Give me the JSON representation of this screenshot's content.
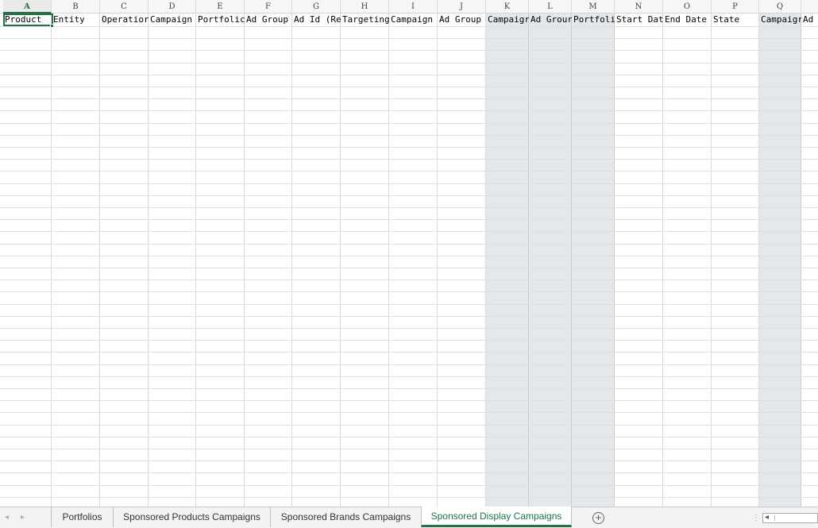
{
  "grid": {
    "columns": [
      {
        "letter": "A",
        "header": "Product",
        "shaded": false,
        "active": true
      },
      {
        "letter": "B",
        "header": "Entity",
        "shaded": false
      },
      {
        "letter": "C",
        "header": "Operatior",
        "shaded": false
      },
      {
        "letter": "D",
        "header": "Campaign",
        "shaded": false
      },
      {
        "letter": "E",
        "header": "Portfolic",
        "shaded": false
      },
      {
        "letter": "F",
        "header": "Ad Group",
        "shaded": false
      },
      {
        "letter": "G",
        "header": "Ad Id (Re",
        "shaded": false
      },
      {
        "letter": "H",
        "header": "Targeting",
        "shaded": false
      },
      {
        "letter": "I",
        "header": "Campaign",
        "shaded": false
      },
      {
        "letter": "J",
        "header": "Ad Group",
        "shaded": false
      },
      {
        "letter": "K",
        "header": "Campaigr",
        "shaded": true
      },
      {
        "letter": "L",
        "header": "Ad Grour",
        "shaded": true
      },
      {
        "letter": "M",
        "header": "Portfoli",
        "shaded": true
      },
      {
        "letter": "N",
        "header": "Start Dat",
        "shaded": false
      },
      {
        "letter": "O",
        "header": "End Date",
        "shaded": false
      },
      {
        "letter": "P",
        "header": "State",
        "shaded": false
      },
      {
        "letter": "Q",
        "header": "Campaigr",
        "shaded": true
      },
      {
        "letter": "",
        "header": "Ad",
        "shaded": false
      }
    ]
  },
  "tabs": {
    "items": [
      {
        "label": "Portfolios",
        "active": false
      },
      {
        "label": "Sponsored Products Campaigns",
        "active": false
      },
      {
        "label": "Sponsored Brands Campaigns",
        "active": false
      },
      {
        "label": "Sponsored Display Campaigns",
        "active": true
      }
    ],
    "add_icon": "plus-circle-icon",
    "prev_icon": "◂",
    "next_icon": "▸",
    "separator": "⋮",
    "scroll_left_icon": "◂"
  },
  "colors": {
    "accent": "#217346",
    "shaded_column": "#e4e7eb",
    "gridline": "#dfdfdf"
  }
}
